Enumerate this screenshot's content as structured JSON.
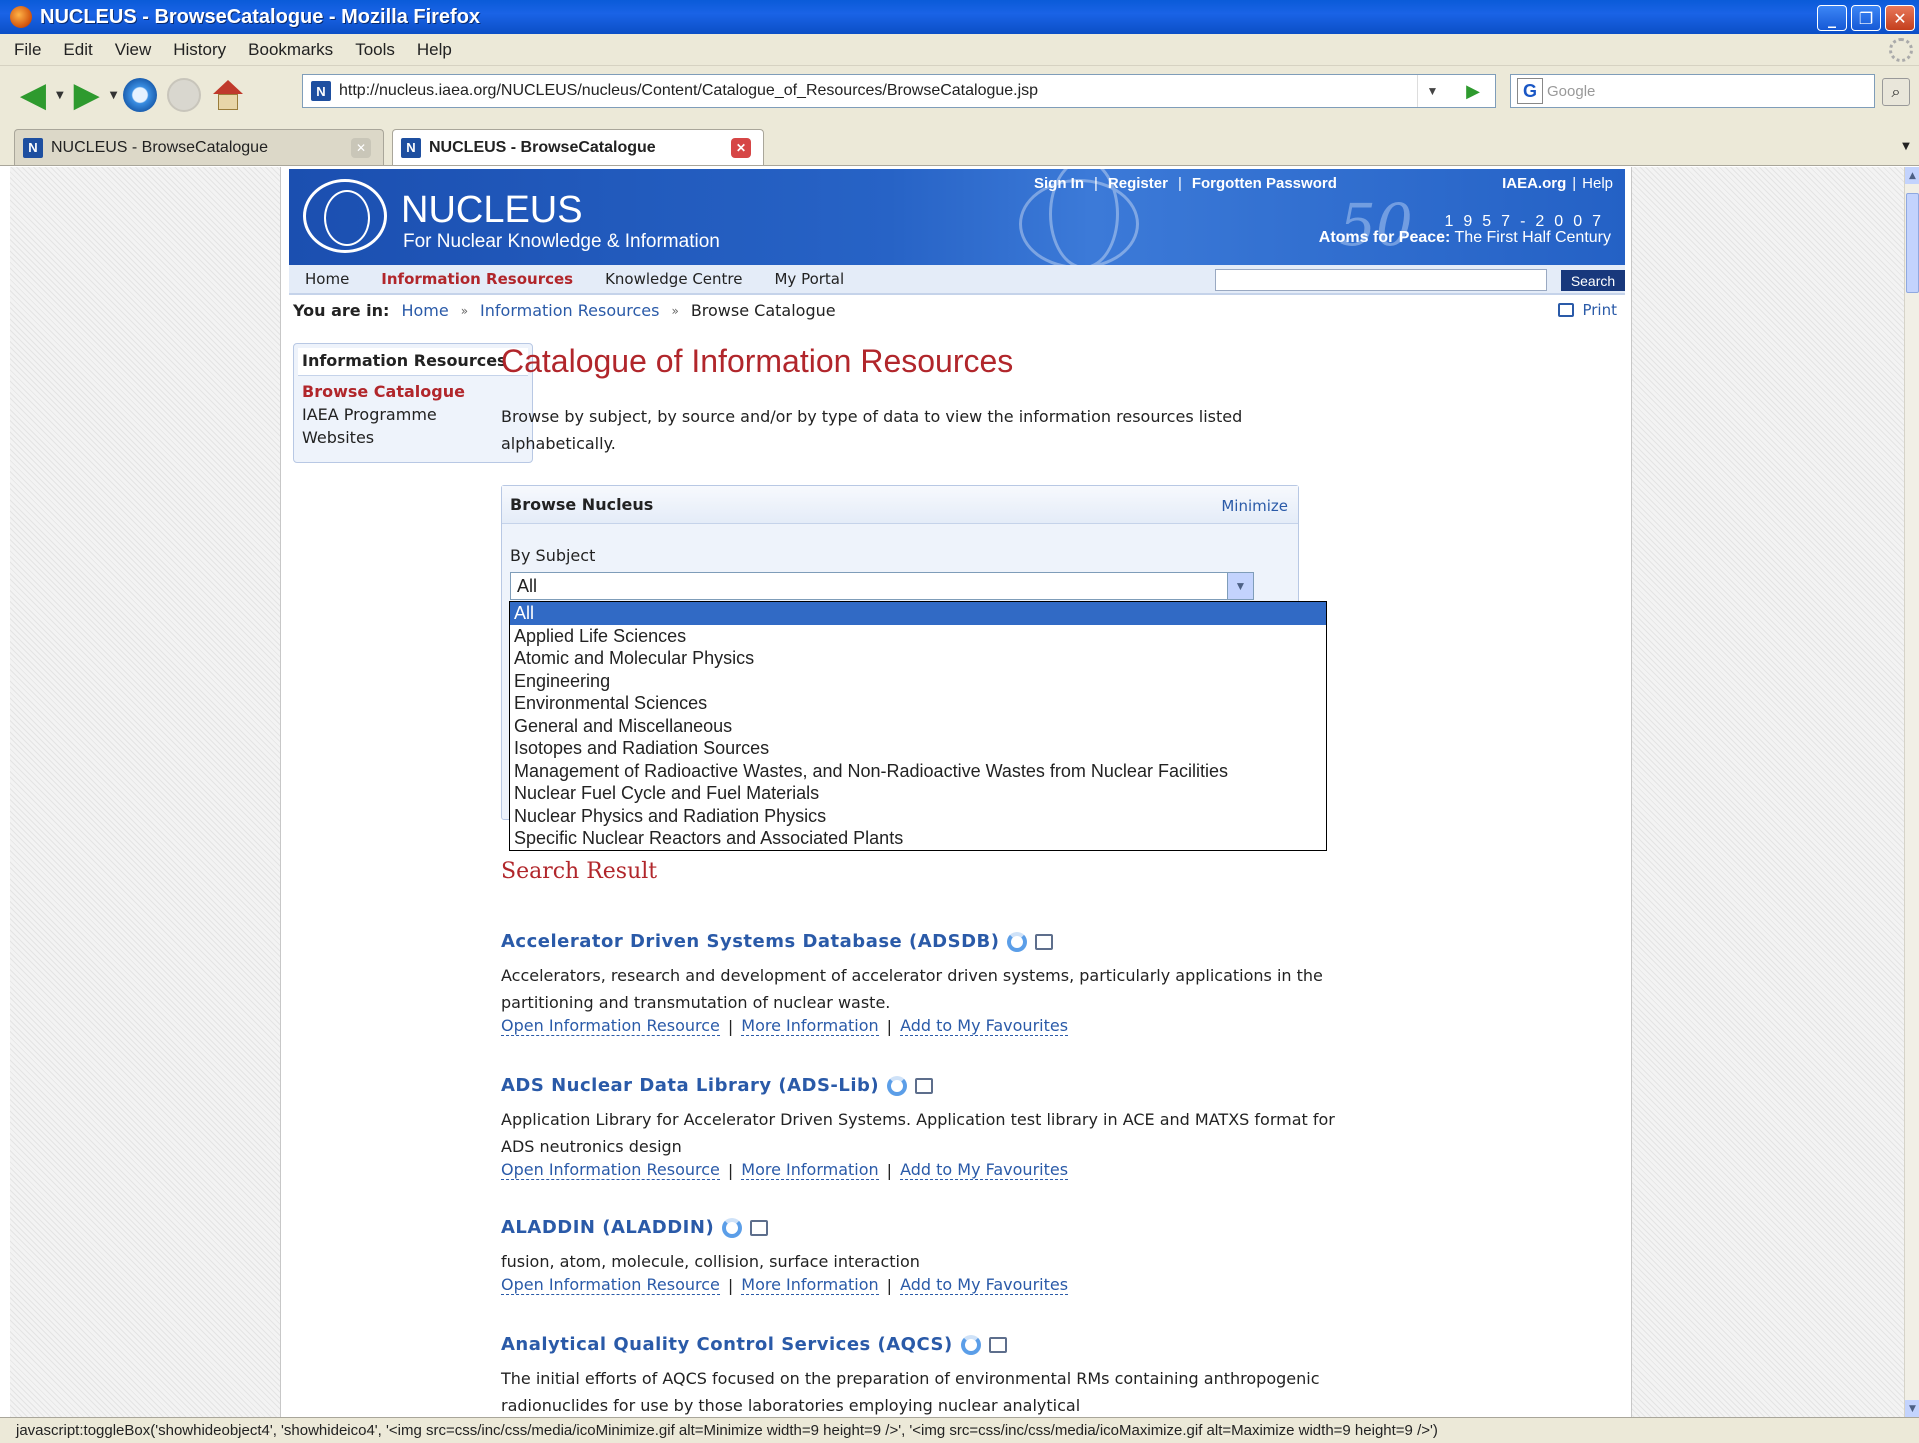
{
  "window": {
    "title": "NUCLEUS - BrowseCatalogue - Mozilla Firefox"
  },
  "menu": [
    "File",
    "Edit",
    "View",
    "History",
    "Bookmarks",
    "Tools",
    "Help"
  ],
  "navbar": {
    "url": "http://nucleus.iaea.org/NUCLEUS/nucleus/Content/Catalogue_of_Resources/BrowseCatalogue.jsp",
    "search_placeholder": "Google"
  },
  "tabs": [
    {
      "label": "NUCLEUS - BrowseCatalogue"
    },
    {
      "label": "NUCLEUS - BrowseCatalogue"
    }
  ],
  "site": {
    "logo_title": "NUCLEUS",
    "logo_subtitle": "For Nuclear Knowledge & Information",
    "top_links": [
      "Sign In",
      "Register",
      "Forgotten Password"
    ],
    "iaea_link": "IAEA.org",
    "help_link": "Help",
    "years": "1957-2007",
    "atoms_bold": "Atoms for Peace:",
    "atoms_rest": "The First Half Century",
    "nav": [
      "Home",
      "Information Resources",
      "Knowledge Centre",
      "My Portal"
    ],
    "search_button": "Search"
  },
  "breadcrumb": {
    "label": "You are in:",
    "items": [
      "Home",
      "Information Resources",
      "Browse Catalogue"
    ],
    "print": "Print"
  },
  "sidebar": {
    "header": "Information Resources",
    "items": [
      "Browse Catalogue",
      "IAEA Programme",
      "Websites"
    ]
  },
  "main": {
    "title": "Catalogue of Information Resources",
    "intro": "Browse by subject, by source and/or by type of data to view the information resources listed alphabetically.",
    "browse_box": {
      "title": "Browse Nucleus",
      "minimize": "Minimize",
      "by_subject_label": "By Subject",
      "selected": "All",
      "options": [
        "All",
        "Applied Life Sciences",
        "Atomic and Molecular Physics",
        "Engineering",
        "Environmental Sciences",
        "General and Miscellaneous",
        "Isotopes and Radiation Sources",
        "Management of Radioactive Wastes, and Non-Radioactive Wastes from Nuclear Facilities",
        "Nuclear Fuel Cycle and Fuel Materials",
        "Nuclear Physics and Radiation Physics",
        "Specific Nuclear Reactors and Associated Plants"
      ]
    },
    "search_result_label": "Search Result",
    "link_labels": [
      "Open Information Resource",
      "More Information",
      "Add to My Favourites"
    ],
    "resources": [
      {
        "title": "Accelerator Driven Systems Database (ADSDB)",
        "desc": "Accelerators, research and development of accelerator driven systems, particularly applications in the partitioning and transmutation of nuclear waste."
      },
      {
        "title": "ADS Nuclear Data Library (ADS-Lib)",
        "desc": "Application Library for Accelerator Driven Systems. Application test library in ACE and MATXS format for ADS neutronics design"
      },
      {
        "title": "ALADDIN (ALADDIN)",
        "desc": "fusion, atom, molecule, collision, surface interaction"
      },
      {
        "title": "Analytical Quality Control Services (AQCS)",
        "desc": "The initial efforts of AQCS focused on the preparation of environmental RMs containing anthropogenic radionuclides for use by those laboratories employing nuclear analytical"
      }
    ]
  },
  "status": "javascript:toggleBox('showhideobject4', 'showhideico4', '<img src=css/inc/css/media/icoMinimize.gif alt=Minimize width=9 height=9 />', '<img src=css/inc/css/media/icoMaximize.gif alt=Maximize width=9 height=9 />')"
}
